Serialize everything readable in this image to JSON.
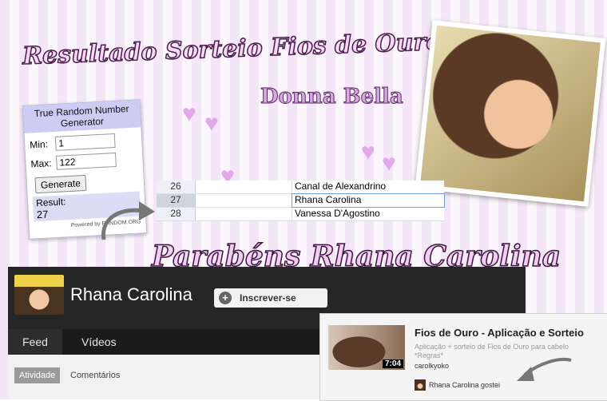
{
  "banner": {
    "title": "Resultado Sorteio Fios de Ouro",
    "brand": "Donna Bella",
    "congrats": "Parabéns Rhana Carolina"
  },
  "rng": {
    "header": "True Random Number Generator",
    "min_label": "Min:",
    "min_value": "1",
    "max_label": "Max:",
    "max_value": "122",
    "generate_label": "Generate",
    "result_label": "Result:",
    "result_value": "27",
    "powered_by": "Powered by RANDOM.ORG"
  },
  "sheet": {
    "rows": [
      {
        "num": "26",
        "name": "Canal de Alexandrino"
      },
      {
        "num": "27",
        "name": "Rhana Carolina"
      },
      {
        "num": "28",
        "name": "Vanessa D'Agostino"
      }
    ]
  },
  "channel": {
    "name": "Rhana Carolina",
    "subscribe_label": "Inscrever-se",
    "subscribe_icon": "+",
    "tabs": [
      "Feed",
      "Vídeos"
    ],
    "activity_chip": "Atividade",
    "comments_label": "Comentários"
  },
  "video_card": {
    "title": "Fios de Ouro - Aplicação e Sorteio",
    "description": "Aplicação + sorteio de Fios de Ouro para cabelo *Regras*",
    "author": "carolkyoko",
    "duration": "7:04",
    "liked_by": "Rhana Carolina gostei"
  },
  "colors": {
    "accent": "#cc181e",
    "rng_header": "#ccccf4"
  }
}
